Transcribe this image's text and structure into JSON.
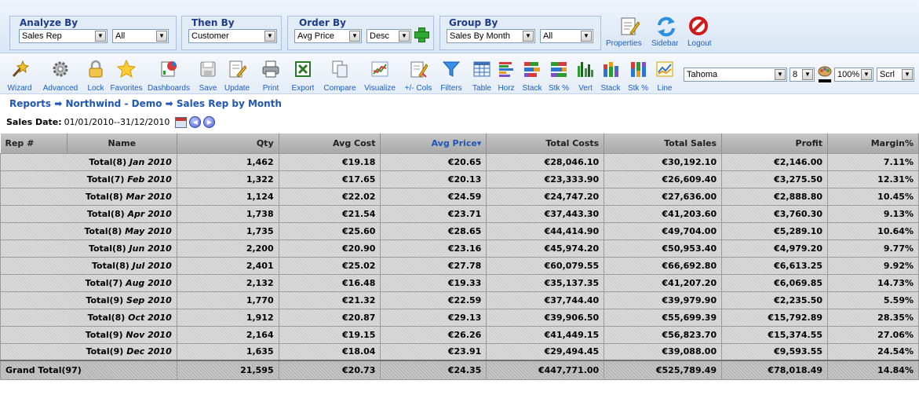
{
  "selectors": {
    "analyze_by": {
      "title": "Analyze By",
      "value": "Sales Rep",
      "filter": "All"
    },
    "then_by": {
      "title": "Then By",
      "value": "Customer"
    },
    "order_by": {
      "title": "Order By",
      "value": "Avg Price",
      "direction": "Desc"
    },
    "group_by": {
      "title": "Group By",
      "value": "Sales By Month",
      "filter": "All"
    }
  },
  "top_actions": [
    {
      "label": "Properties",
      "icon": "properties-icon"
    },
    {
      "label": "Sidebar",
      "icon": "sidebar-refresh-icon"
    },
    {
      "label": "Logout",
      "icon": "logout-icon"
    }
  ],
  "toolbar": [
    {
      "label": "Wizard",
      "icon": "wizard-icon"
    },
    {
      "label": "Advanced",
      "icon": "gear-icon"
    },
    {
      "label": "Lock",
      "icon": "lock-icon"
    },
    {
      "label": "Favorites",
      "icon": "star-icon"
    },
    {
      "label": "Dashboards",
      "icon": "dashboard-icon"
    },
    {
      "label": "Save",
      "icon": "save-icon"
    },
    {
      "label": "Update",
      "icon": "update-icon"
    },
    {
      "label": "Print",
      "icon": "printer-icon"
    },
    {
      "label": "Export",
      "icon": "excel-icon"
    },
    {
      "label": "Compare",
      "icon": "compare-icon"
    },
    {
      "label": "Visualize",
      "icon": "chart-icon"
    },
    {
      "label": "+/- Cols",
      "icon": "columns-icon"
    },
    {
      "label": "Filters",
      "icon": "filter-icon"
    },
    {
      "label": "Table",
      "icon": "table-icon"
    },
    {
      "label": "Horz",
      "icon": "horizontal-bar-icon"
    },
    {
      "label": "Stack",
      "icon": "stacked-bar-icon"
    },
    {
      "label": "Stk %",
      "icon": "stacked-percent-icon"
    },
    {
      "label": "Vert",
      "icon": "vertical-bar-icon"
    },
    {
      "label": "Stack",
      "icon": "stacked-column-icon"
    },
    {
      "label": "Stk %",
      "icon": "stacked-column-percent-icon"
    },
    {
      "label": "Line",
      "icon": "line-chart-icon"
    }
  ],
  "font_controls": {
    "font": "Tahoma",
    "size": "8",
    "zoom": "100%",
    "scroll": "Scrl"
  },
  "breadcrumb": {
    "items": [
      "Reports",
      "Northwind - Demo",
      "Sales Rep by Month"
    ],
    "separator": "➡"
  },
  "date_filter": {
    "label": "Sales Date:",
    "value": "01/01/2010--31/12/2010"
  },
  "table": {
    "columns": [
      "Rep #",
      "Name",
      "Qty",
      "Avg Cost",
      "Avg Price▾",
      "Total Costs",
      "Total Sales",
      "Profit",
      "Margin%"
    ],
    "sorted_column": "Avg Price▾",
    "rows": [
      {
        "prefix": "Total(8)",
        "period": "Jan 2010",
        "qty": "1,462",
        "avg_cost": "€19.18",
        "avg_price": "€20.65",
        "total_costs": "€28,046.10",
        "total_sales": "€30,192.10",
        "profit": "€2,146.00",
        "margin": "7.11%"
      },
      {
        "prefix": "Total(7)",
        "period": "Feb 2010",
        "qty": "1,322",
        "avg_cost": "€17.65",
        "avg_price": "€20.13",
        "total_costs": "€23,333.90",
        "total_sales": "€26,609.40",
        "profit": "€3,275.50",
        "margin": "12.31%"
      },
      {
        "prefix": "Total(8)",
        "period": "Mar 2010",
        "qty": "1,124",
        "avg_cost": "€22.02",
        "avg_price": "€24.59",
        "total_costs": "€24,747.20",
        "total_sales": "€27,636.00",
        "profit": "€2,888.80",
        "margin": "10.45%"
      },
      {
        "prefix": "Total(8)",
        "period": "Apr 2010",
        "qty": "1,738",
        "avg_cost": "€21.54",
        "avg_price": "€23.71",
        "total_costs": "€37,443.30",
        "total_sales": "€41,203.60",
        "profit": "€3,760.30",
        "margin": "9.13%"
      },
      {
        "prefix": "Total(8)",
        "period": "May 2010",
        "qty": "1,735",
        "avg_cost": "€25.60",
        "avg_price": "€28.65",
        "total_costs": "€44,414.90",
        "total_sales": "€49,704.00",
        "profit": "€5,289.10",
        "margin": "10.64%"
      },
      {
        "prefix": "Total(8)",
        "period": "Jun 2010",
        "qty": "2,200",
        "avg_cost": "€20.90",
        "avg_price": "€23.16",
        "total_costs": "€45,974.20",
        "total_sales": "€50,953.40",
        "profit": "€4,979.20",
        "margin": "9.77%"
      },
      {
        "prefix": "Total(8)",
        "period": "Jul 2010",
        "qty": "2,401",
        "avg_cost": "€25.02",
        "avg_price": "€27.78",
        "total_costs": "€60,079.55",
        "total_sales": "€66,692.80",
        "profit": "€6,613.25",
        "margin": "9.92%"
      },
      {
        "prefix": "Total(7)",
        "period": "Aug 2010",
        "qty": "2,132",
        "avg_cost": "€16.48",
        "avg_price": "€19.33",
        "total_costs": "€35,137.35",
        "total_sales": "€41,207.20",
        "profit": "€6,069.85",
        "margin": "14.73%"
      },
      {
        "prefix": "Total(9)",
        "period": "Sep 2010",
        "qty": "1,770",
        "avg_cost": "€21.32",
        "avg_price": "€22.59",
        "total_costs": "€37,744.40",
        "total_sales": "€39,979.90",
        "profit": "€2,235.50",
        "margin": "5.59%"
      },
      {
        "prefix": "Total(8)",
        "period": "Oct 2010",
        "qty": "1,912",
        "avg_cost": "€20.87",
        "avg_price": "€29.13",
        "total_costs": "€39,906.50",
        "total_sales": "€55,699.39",
        "profit": "€15,792.89",
        "margin": "28.35%"
      },
      {
        "prefix": "Total(9)",
        "period": "Nov 2010",
        "qty": "2,164",
        "avg_cost": "€19.15",
        "avg_price": "€26.26",
        "total_costs": "€41,449.15",
        "total_sales": "€56,823.70",
        "profit": "€15,374.55",
        "margin": "27.06%"
      },
      {
        "prefix": "Total(9)",
        "period": "Dec 2010",
        "qty": "1,635",
        "avg_cost": "€18.04",
        "avg_price": "€23.91",
        "total_costs": "€29,494.45",
        "total_sales": "€39,088.00",
        "profit": "€9,593.55",
        "margin": "24.54%"
      }
    ],
    "grand_total": {
      "label": "Grand Total(97)",
      "qty": "21,595",
      "avg_cost": "€20.73",
      "avg_price": "€24.35",
      "total_costs": "€447,771.00",
      "total_sales": "€525,789.49",
      "profit": "€78,018.49",
      "margin": "14.84%"
    }
  },
  "colors": {
    "accent": "#1f56b8",
    "header_bg": "#b8b8b8",
    "row_bg": "#cfcfcf"
  }
}
